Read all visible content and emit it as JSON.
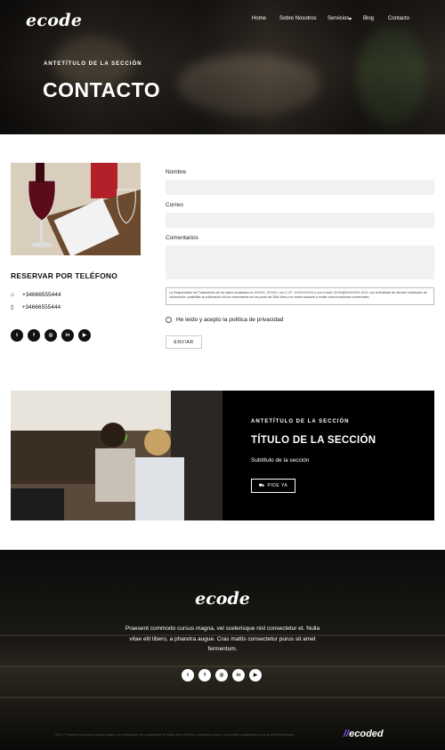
{
  "header": {
    "logo": "ecode",
    "nav": [
      {
        "label": "Home"
      },
      {
        "label": "Sobre Nosotros"
      },
      {
        "label": "Servicios",
        "has_dropdown": true
      },
      {
        "label": "Blog"
      },
      {
        "label": "Contacto"
      }
    ]
  },
  "hero": {
    "pretitle": "ANTETÍTULO DE LA SECCIÓN",
    "title": "CONTACTO"
  },
  "contact": {
    "reserve_title": "RESERVAR POR TELÉFONO",
    "phones": [
      {
        "icon": "home-icon",
        "number": "+34666555444"
      },
      {
        "icon": "mobile-phone-icon",
        "number": "+34666555444"
      }
    ],
    "socials": [
      {
        "name": "twitter",
        "glyph": "t"
      },
      {
        "name": "facebook",
        "glyph": "f"
      },
      {
        "name": "instagram",
        "glyph": "◎"
      },
      {
        "name": "linkedin",
        "glyph": "in"
      },
      {
        "name": "youtube",
        "glyph": "▶"
      }
    ]
  },
  "form": {
    "name_label": "Nombre",
    "email_label": "Correo",
    "comments_label": "Comentarios",
    "name_value": "",
    "email_value": "",
    "comments_value": "",
    "legal_text": "La Responsable del Tratamiento de los datos recabados es XXXXX, XXXXX, con C.I.F.: XXXXXXXXX y con e-mail: XXXX@XXXXXXX.XXX, con la finalidad de atender solicitudes de información, posibilitar la publicación de los comentarios en los posts del Sitio Web y en redes sociales y remitir comunicaciones comerciales.",
    "privacy_label": "He leído y acepto la política de privacidad",
    "submit_label": "ENVIAR"
  },
  "promo": {
    "pretitle": "ANTETÍTULO DE LA SECCIÓN",
    "title": "TÍTULO DE LA SECCIÓN",
    "subtitle": "Subtítulo de la sección",
    "button_label": "PIDE YA"
  },
  "footer": {
    "logo": "ecode",
    "text": "Praesent commodo cursus magna, vel scelerisque nisl consectetur et. Nulla vitae elit libero, a pharetra augue. Cras mattis consectetur purus sit amet fermentum.",
    "copyright": "2021 © Praesent commodo cursus magna, vel scelerisque nisl consectetur et. Nulla vitae elit libero, a pharetra augue. Cras mattis consectetur purus sit amet fermentum.",
    "credit": "ecoded"
  },
  "colors": {
    "accent": "#7b5cff",
    "dark": "#000000",
    "input_bg": "#f1f1f1"
  }
}
